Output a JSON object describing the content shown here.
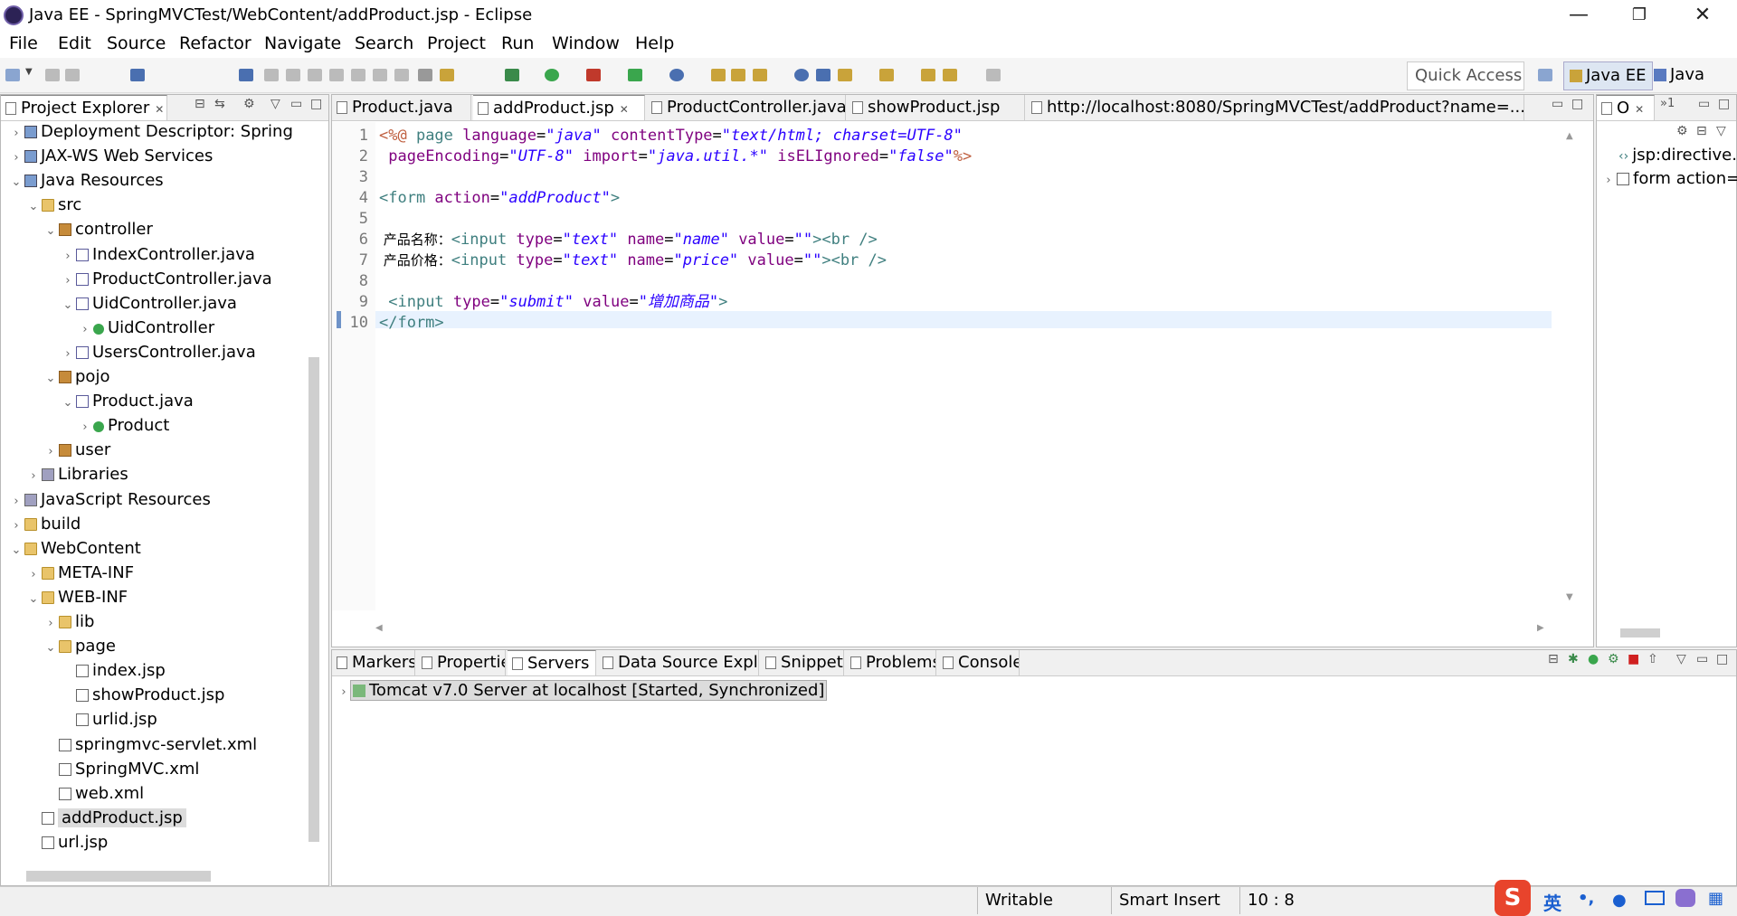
{
  "window": {
    "title": "Java EE - SpringMVCTest/WebContent/addProduct.jsp - Eclipse"
  },
  "menu": [
    "File",
    "Edit",
    "Source",
    "Refactor",
    "Navigate",
    "Search",
    "Project",
    "Run",
    "Window",
    "Help"
  ],
  "toolbar": {
    "quick_access": "Quick Access",
    "perspectives": [
      "Java EE",
      "Java"
    ]
  },
  "project_explorer": {
    "tab_label": "Project Explorer",
    "items": [
      {
        "label": "Deployment Descriptor: Spring",
        "indent": 1,
        "twisty": "›",
        "icon": "proj"
      },
      {
        "label": "JAX-WS Web Services",
        "indent": 1,
        "twisty": "›",
        "icon": "proj"
      },
      {
        "label": "Java Resources",
        "indent": 1,
        "twisty": "⌄",
        "icon": "proj"
      },
      {
        "label": "src",
        "indent": 2,
        "twisty": "⌄",
        "icon": "folder"
      },
      {
        "label": "controller",
        "indent": 3,
        "twisty": "⌄",
        "icon": "pkg"
      },
      {
        "label": "IndexController.java",
        "indent": 4,
        "twisty": "›",
        "icon": "java"
      },
      {
        "label": "ProductController.java",
        "indent": 4,
        "twisty": "›",
        "icon": "java"
      },
      {
        "label": "UidController.java",
        "indent": 4,
        "twisty": "⌄",
        "icon": "java"
      },
      {
        "label": "UidController",
        "indent": 5,
        "twisty": "›",
        "icon": "cls"
      },
      {
        "label": "UsersController.java",
        "indent": 4,
        "twisty": "›",
        "icon": "java"
      },
      {
        "label": "pojo",
        "indent": 3,
        "twisty": "⌄",
        "icon": "pkg"
      },
      {
        "label": "Product.java",
        "indent": 4,
        "twisty": "⌄",
        "icon": "java"
      },
      {
        "label": "Product",
        "indent": 5,
        "twisty": "›",
        "icon": "cls"
      },
      {
        "label": "user",
        "indent": 3,
        "twisty": "›",
        "icon": "pkg"
      },
      {
        "label": "Libraries",
        "indent": 2,
        "twisty": "›",
        "icon": "lib"
      },
      {
        "label": "JavaScript Resources",
        "indent": 1,
        "twisty": "›",
        "icon": "lib"
      },
      {
        "label": "build",
        "indent": 1,
        "twisty": "›",
        "icon": "folder"
      },
      {
        "label": "WebContent",
        "indent": 1,
        "twisty": "⌄",
        "icon": "folder"
      },
      {
        "label": "META-INF",
        "indent": 2,
        "twisty": "›",
        "icon": "folder"
      },
      {
        "label": "WEB-INF",
        "indent": 2,
        "twisty": "⌄",
        "icon": "folder"
      },
      {
        "label": "lib",
        "indent": 3,
        "twisty": "›",
        "icon": "folder"
      },
      {
        "label": "page",
        "indent": 3,
        "twisty": "⌄",
        "icon": "folder"
      },
      {
        "label": "index.jsp",
        "indent": 4,
        "twisty": "",
        "icon": "xml"
      },
      {
        "label": "showProduct.jsp",
        "indent": 4,
        "twisty": "",
        "icon": "xml"
      },
      {
        "label": "urlid.jsp",
        "indent": 4,
        "twisty": "",
        "icon": "xml"
      },
      {
        "label": "springmvc-servlet.xml",
        "indent": 3,
        "twisty": "",
        "icon": "xml"
      },
      {
        "label": "SpringMVC.xml",
        "indent": 3,
        "twisty": "",
        "icon": "xml"
      },
      {
        "label": "web.xml",
        "indent": 3,
        "twisty": "",
        "icon": "xml"
      },
      {
        "label": "addProduct.jsp",
        "indent": 2,
        "twisty": "",
        "icon": "xml",
        "selected": true
      },
      {
        "label": "url.jsp",
        "indent": 2,
        "twisty": "",
        "icon": "xml"
      }
    ]
  },
  "editor_tabs": [
    {
      "label": "Product.java",
      "active": false
    },
    {
      "label": "addProduct.jsp",
      "active": true
    },
    {
      "label": "ProductController.java",
      "active": false
    },
    {
      "label": "showProduct.jsp",
      "active": false
    },
    {
      "label": "http://localhost:8080/SpringMVCTest/addProduct?name=...",
      "active": false
    }
  ],
  "editor": {
    "lines": [
      {
        "n": "1",
        "parts": [
          [
            "dir",
            "<%@ "
          ],
          [
            "kw",
            "page "
          ],
          [
            "attr",
            "language"
          ],
          [
            "",
            "="
          ],
          [
            "str",
            "\"java\""
          ],
          [
            "",
            " "
          ],
          [
            "attr",
            "contentType"
          ],
          [
            "",
            "="
          ],
          [
            "str",
            "\"text/html; charset=UTF-8\""
          ]
        ]
      },
      {
        "n": "2",
        "parts": [
          [
            "",
            " "
          ],
          [
            "attr",
            "pageEncoding"
          ],
          [
            "",
            "="
          ],
          [
            "str",
            "\"UTF-8\""
          ],
          [
            "",
            " "
          ],
          [
            "attr",
            "import"
          ],
          [
            "",
            "="
          ],
          [
            "str",
            "\"java.util.*\""
          ],
          [
            "",
            " "
          ],
          [
            "attr",
            "isELIgnored"
          ],
          [
            "",
            "="
          ],
          [
            "str",
            "\"false\""
          ],
          [
            "dir",
            "%>"
          ]
        ]
      },
      {
        "n": "3",
        "parts": []
      },
      {
        "n": "4",
        "parts": [
          [
            "kw",
            "<form "
          ],
          [
            "attr",
            "action"
          ],
          [
            "",
            "="
          ],
          [
            "str",
            "\"addProduct\""
          ],
          [
            "kw",
            ">"
          ]
        ]
      },
      {
        "n": "5",
        "parts": []
      },
      {
        "n": "6",
        "parts": [
          [
            "txt",
            " 产品名称："
          ],
          [
            "kw",
            "<input "
          ],
          [
            "attr",
            "type"
          ],
          [
            "",
            "="
          ],
          [
            "str",
            "\"text\""
          ],
          [
            "",
            " "
          ],
          [
            "attr",
            "name"
          ],
          [
            "",
            "="
          ],
          [
            "str",
            "\"name\""
          ],
          [
            "",
            " "
          ],
          [
            "attr",
            "value"
          ],
          [
            "",
            "="
          ],
          [
            "str",
            "\"\""
          ],
          [
            "kw",
            "><br />"
          ]
        ]
      },
      {
        "n": "7",
        "parts": [
          [
            "txt",
            " 产品价格："
          ],
          [
            "kw",
            "<input "
          ],
          [
            "attr",
            "type"
          ],
          [
            "",
            "="
          ],
          [
            "str",
            "\"text\""
          ],
          [
            "",
            " "
          ],
          [
            "attr",
            "name"
          ],
          [
            "",
            "="
          ],
          [
            "str",
            "\"price\""
          ],
          [
            "",
            " "
          ],
          [
            "attr",
            "value"
          ],
          [
            "",
            "="
          ],
          [
            "str",
            "\"\""
          ],
          [
            "kw",
            "><br />"
          ]
        ]
      },
      {
        "n": "8",
        "parts": []
      },
      {
        "n": "9",
        "parts": [
          [
            "",
            " "
          ],
          [
            "kw",
            "<input "
          ],
          [
            "attr",
            "type"
          ],
          [
            "",
            "="
          ],
          [
            "str",
            "\"submit\""
          ],
          [
            "",
            " "
          ],
          [
            "attr",
            "value"
          ],
          [
            "",
            "="
          ],
          [
            "str",
            "\"增加商品\""
          ],
          [
            "kw",
            ">"
          ]
        ]
      },
      {
        "n": "10",
        "parts": [
          [
            "kw",
            "</form>"
          ]
        ]
      }
    ]
  },
  "outline": {
    "tab_label": "O",
    "items": [
      "jsp:directive.",
      "form action="
    ]
  },
  "bottom_tabs": [
    "Markers",
    "Properties",
    "Servers",
    "Data Source Explorer",
    "Snippets",
    "Problems",
    "Console"
  ],
  "servers": {
    "entry": "Tomcat v7.0 Server at localhost  [Started, Synchronized]"
  },
  "statusbar": {
    "writable": "Writable",
    "insert_mode": "Smart Insert",
    "position": "10 : 8"
  },
  "ime": {
    "lang": "英",
    "punct": "•,"
  }
}
